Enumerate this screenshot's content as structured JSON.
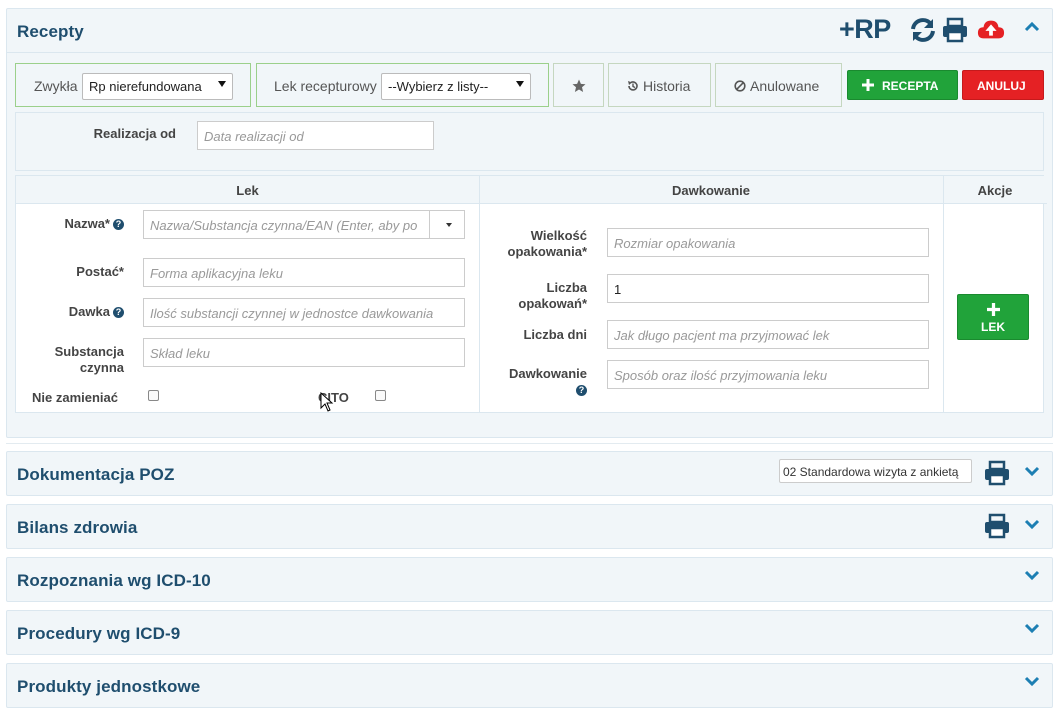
{
  "recepty": {
    "title": "Recepty",
    "add_rp_label": "+RP",
    "toolbar": {
      "zwykla_label": "Zwykła",
      "zwykla_value": "Rp nierefundowana",
      "lek_recepturowy_label": "Lek recepturowy",
      "lek_recepturowy_value": "--Wybierz z listy--",
      "historia_label": "Historia",
      "anulowane_label": "Anulowane",
      "recepta_label": "RECEPTA",
      "anuluj_label": "ANULUJ"
    },
    "realizacja": {
      "label": "Realizacja od",
      "placeholder": "Data realizacji od"
    },
    "table": {
      "col_lek": "Lek",
      "col_dawkowanie": "Dawkowanie",
      "col_akcje": "Akcje",
      "nazwa_label": "Nazwa*",
      "nazwa_placeholder": "Nazwa/Substancja czynna/EAN (Enter, aby po",
      "postac_label": "Postać*",
      "postac_placeholder": "Forma aplikacyjna leku",
      "dawka_label": "Dawka",
      "dawka_placeholder": "Ilość substancji czynnej w jednostce dawkowania",
      "substancja_label_1": "Substancja",
      "substancja_label_2": "czynna",
      "substancja_placeholder": "Skład leku",
      "nie_zamieniac_label": "Nie zamieniać",
      "cito_label": "CITO",
      "wielkosc_label_1": "Wielkość",
      "wielkosc_label_2": "opakowania*",
      "wielkosc_placeholder": "Rozmiar opakowania",
      "liczba_opak_label_1": "Liczba",
      "liczba_opak_label_2": "opakowań*",
      "liczba_opak_value": "1",
      "liczba_dni_label": "Liczba dni",
      "liczba_dni_placeholder": "Jak długo pacjent ma przyjmować lek",
      "dawkowanie_label": "Dawkowanie",
      "dawkowanie_placeholder": "Sposób oraz ilość przyjmowania leku",
      "lek_button_label": "LEK"
    }
  },
  "sections": [
    {
      "title": "Dokumentacja POZ",
      "select_value": "02 Standardowa wizyta z ankietą"
    },
    {
      "title": "Bilans zdrowia"
    },
    {
      "title": "Rozpoznania wg ICD-10"
    },
    {
      "title": "Procedury wg ICD-9"
    },
    {
      "title": "Produkty jednostkowe"
    }
  ],
  "colors": {
    "title": "#1f4e6e",
    "accent_icon": "#1f4e6e",
    "upload_icon": "#e52124",
    "green": "#21a33a",
    "red": "#e52124",
    "chevron": "#1d7fb3"
  },
  "icons": {
    "sync": "sync-icon",
    "print": "print-icon",
    "cloud_upload": "cloud-upload-icon",
    "chevron_up": "chevron-up-icon",
    "chevron_down": "chevron-down-icon",
    "star": "star-icon",
    "history": "history-icon",
    "ban": "ban-icon",
    "plus": "plus-icon",
    "help": "question-circle-icon"
  }
}
